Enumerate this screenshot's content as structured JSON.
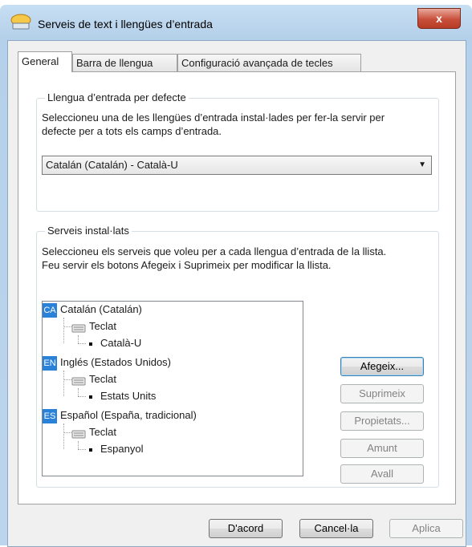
{
  "window": {
    "title": "Serveis de text i llengües d’entrada",
    "close_glyph": "x"
  },
  "tabs": [
    "General",
    "Barra de llengua",
    "Configuració avançada de tecles"
  ],
  "default_language": {
    "group_title": "Llengua d’entrada per defecte",
    "description_line1": "Seleccioneu una de les llengües d’entrada instal·lades per fer-la servir per",
    "description_line2": "defecte per a tots els camps d’entrada.",
    "selected": "Catalán (Catalán) - Català-U"
  },
  "installed": {
    "group_title": "Serveis instal·lats",
    "description_line1": "Seleccioneu els serveis que voleu per a cada llengua d’entrada de la llista.",
    "description_line2": "Feu servir els botons Afegeix i Suprimeix per modificar la llista.",
    "languages": [
      {
        "code": "CA",
        "name": "Catalán (Catalán)",
        "category": "Teclat",
        "layout": "Català-U"
      },
      {
        "code": "EN",
        "name": "Inglés (Estados Unidos)",
        "category": "Teclat",
        "layout": "Estats Units"
      },
      {
        "code": "ES",
        "name": "Español (España, tradicional)",
        "category": "Teclat",
        "layout": "Espanyol"
      }
    ]
  },
  "side_buttons": {
    "add": "Afegeix...",
    "remove": "Suprimeix",
    "properties": "Propietats...",
    "up": "Amunt",
    "down": "Avall"
  },
  "footer_buttons": {
    "ok": "D'acord",
    "cancel": "Cancel·la",
    "apply": "Aplica"
  }
}
